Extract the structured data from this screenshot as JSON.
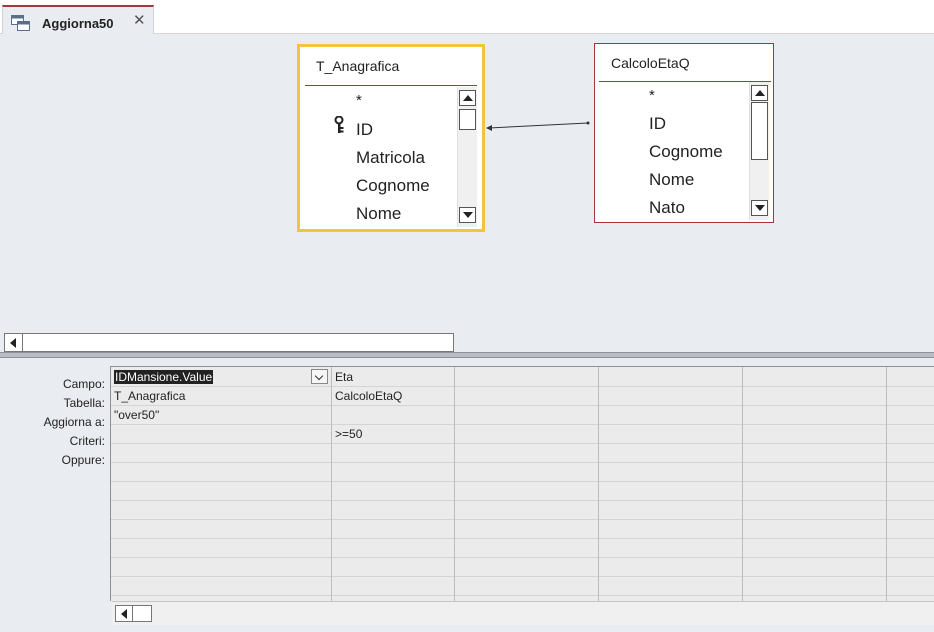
{
  "tab": {
    "title": "Aggiorna50",
    "icon": "query-design-icon",
    "close_glyph": "✕"
  },
  "tables": [
    {
      "name": "T_Anagrafica",
      "fields": [
        "*",
        "ID",
        "Matricola",
        "Cognome",
        "Nome"
      ],
      "key_field": "ID",
      "selected": true
    },
    {
      "name": "CalcoloEtaQ",
      "fields": [
        "*",
        "ID",
        "Cognome",
        "Nome",
        "Nato"
      ],
      "selected": false
    }
  ],
  "grid": {
    "row_labels": [
      "Campo:",
      "Tabella:",
      "Aggiorna a:",
      "Criteri:",
      "Oppure:"
    ],
    "columns": [
      {
        "campo": "IDMansione.Value",
        "tabella": "T_Anagrafica",
        "aggiorna_a": "\"over50\"",
        "criteri": "",
        "oppure": ""
      },
      {
        "campo": "Eta",
        "tabella": "CalcoloEtaQ",
        "aggiorna_a": "",
        "criteri": ">=50",
        "oppure": ""
      }
    ]
  },
  "colors": {
    "accent": "#a4373a",
    "selection": "#f5c342",
    "pane_bg": "#e9ecf0"
  }
}
